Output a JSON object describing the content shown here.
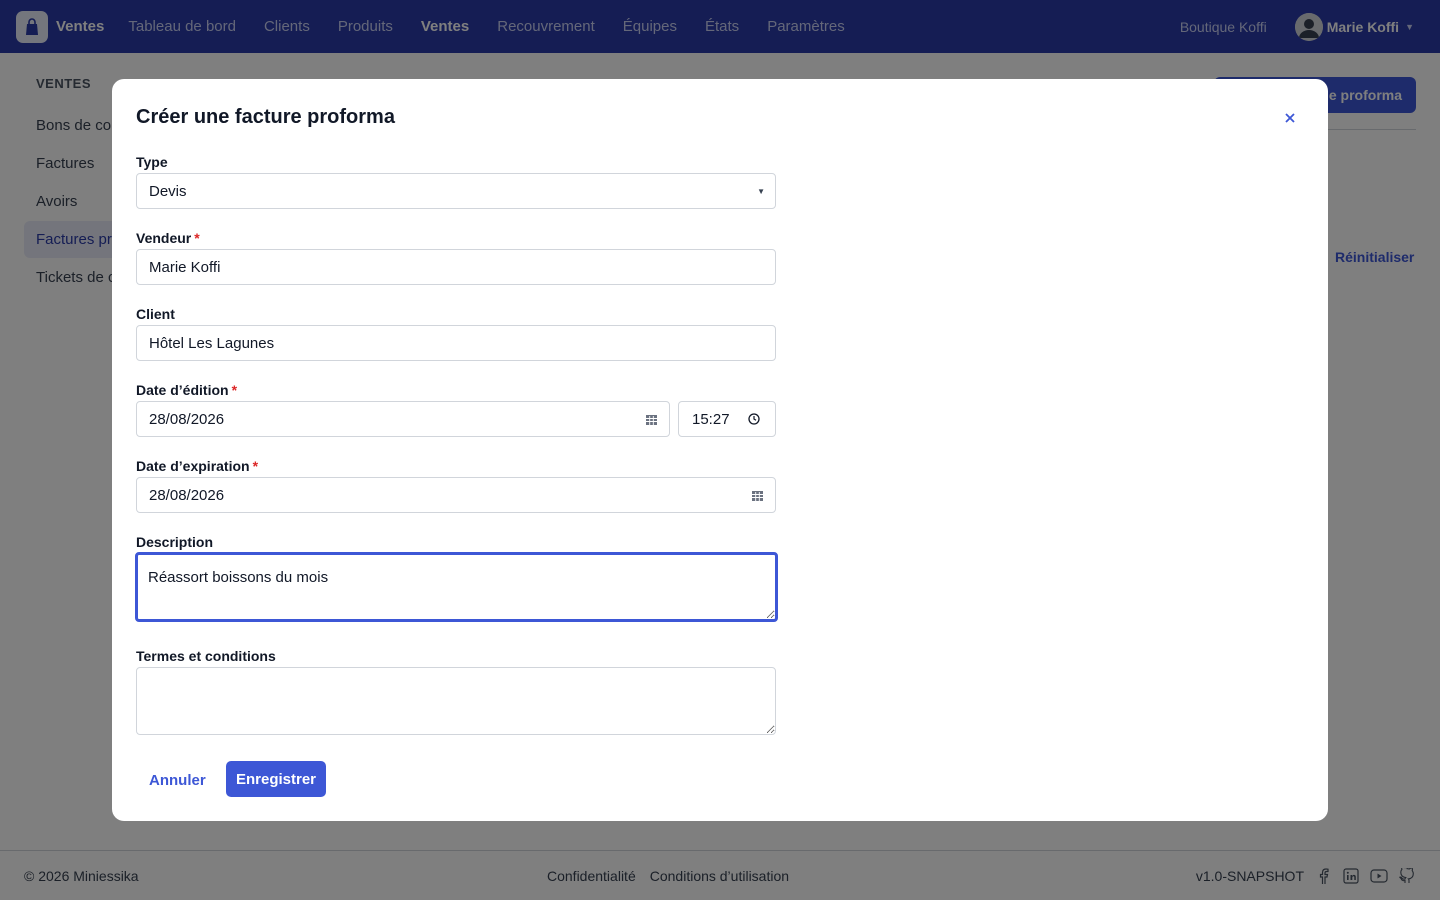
{
  "topnav": {
    "brand": "Ventes",
    "items": [
      "Tableau de bord",
      "Clients",
      "Produits",
      "Ventes",
      "Recouvrement",
      "Équipes",
      "États",
      "Paramètres"
    ],
    "active_index": 3,
    "shop": "Boutique Koffi",
    "user": "Marie Koffi",
    "accent": "#2a3ba8"
  },
  "sidebar": {
    "heading": "VENTES",
    "items": [
      "Bons de co",
      "Factures",
      "Avoirs",
      "Factures pr",
      "Tickets de c"
    ],
    "active_index": 3
  },
  "page": {
    "primary_button": "e proforma",
    "reset": "Réinitialiser"
  },
  "modal": {
    "title": "Créer une facture proforma",
    "close_icon": "close-icon",
    "type": {
      "label": "Type",
      "value": "Devis"
    },
    "seller": {
      "label": "Vendeur",
      "value": "Marie Koffi",
      "required": "*"
    },
    "client": {
      "label": "Client",
      "value": "Hôtel Les Lagunes"
    },
    "issue_date": {
      "label": "Date d’édition",
      "value": "28/08/2026",
      "time": "15:27",
      "required": "*"
    },
    "expiry_date": {
      "label": "Date d’expiration",
      "value": "28/08/2026",
      "required": "*"
    },
    "description": {
      "label": "Description",
      "value": "Réassort boissons du mois"
    },
    "terms": {
      "label": "Termes et conditions",
      "value": ""
    },
    "cancel": "Annuler",
    "save": "Enregistrer",
    "button_color": "#3d57d6"
  },
  "footer": {
    "copyright": "© 2026 Miniessika",
    "links": [
      "Confidentialité",
      "Conditions d’utilisation"
    ],
    "version": "v1.0-SNAPSHOT",
    "social_icons": [
      "facebook-icon",
      "linkedin-icon",
      "youtube-icon",
      "github-icon"
    ]
  }
}
